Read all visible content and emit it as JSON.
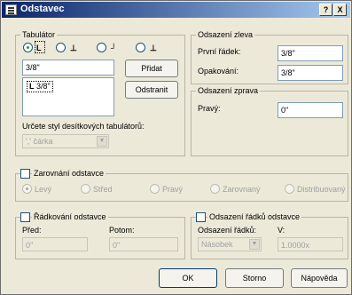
{
  "window": {
    "title": "Odstavec",
    "help_button": "?",
    "close_button": "X"
  },
  "tabulator": {
    "group_title": "Tabulátor",
    "tab_value": "3/8\"",
    "add_button": "Přidat",
    "remove_button": "Odstranit",
    "list_item": "3/8\"",
    "decimal_style_label": "Určete styl desítkových tabulátorů:",
    "decimal_style_value": "',' čárka"
  },
  "left_indent": {
    "group_title": "Odsazení zleva",
    "first_line_label": "První řádek:",
    "first_line_value": "3/8\"",
    "hanging_label": "Opakování:",
    "hanging_value": "3/8\""
  },
  "right_indent": {
    "group_title": "Odsazení zprava",
    "right_label": "Pravý:",
    "right_value": "0\""
  },
  "alignment": {
    "group_title": "Zarovnání odstavce",
    "options": [
      "Levý",
      "Střed",
      "Pravý",
      "Zarovnaný",
      "Distribuovaný"
    ]
  },
  "spacing": {
    "group_title": "Řádkování odstavce",
    "before_label": "Před:",
    "before_value": "0\"",
    "after_label": "Potom:",
    "after_value": "0\""
  },
  "line_spacing": {
    "group_title": "Odsazení řádků odstavce",
    "mode_label": "Odsazení řádků:",
    "mode_value": "Násobek",
    "value_label": "V:",
    "value_value": "1.0000x"
  },
  "footer": {
    "ok": "OK",
    "cancel": "Storno",
    "help": "Nápověda"
  }
}
